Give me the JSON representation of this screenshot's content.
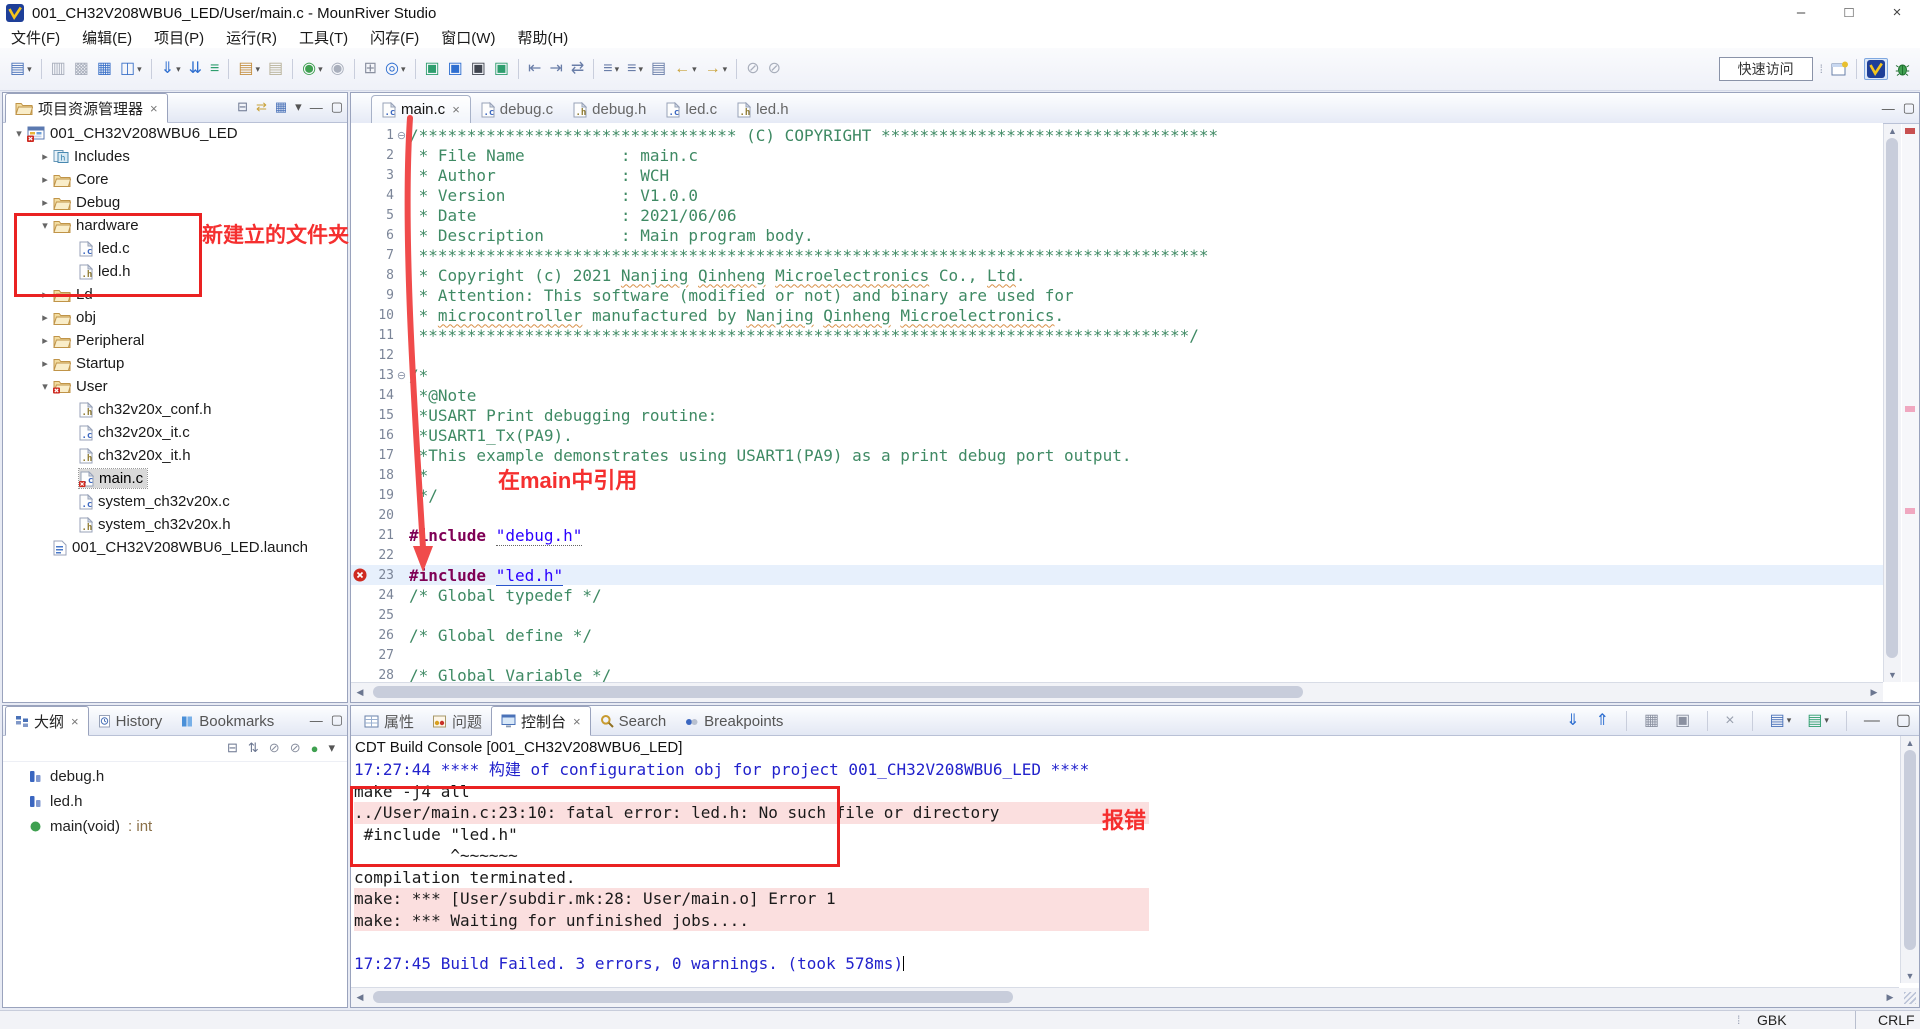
{
  "window": {
    "title": "001_CH32V208WBU6_LED/User/main.c - MounRiver Studio",
    "controls": {
      "minimize": "–",
      "maximize": "□",
      "close": "×"
    }
  },
  "menu": {
    "items": [
      "文件(F)",
      "编辑(E)",
      "项目(P)",
      "运行(R)",
      "工具(T)",
      "闪存(F)",
      "窗口(W)",
      "帮助(H)"
    ]
  },
  "toolbar": {
    "quick_access": "快速访问",
    "items": [
      {
        "name": "new-wizard",
        "g": "▤",
        "c": "#4A72B8",
        "dd": 1
      },
      {
        "sep": 1
      },
      {
        "name": "save",
        "g": "▥",
        "c": "#A9AFBC"
      },
      {
        "name": "save-all",
        "g": "▩",
        "c": "#A9AFBC"
      },
      {
        "name": "open-windows",
        "g": "▦",
        "c": "#3C72C8"
      },
      {
        "name": "perspective-config",
        "g": "◫",
        "c": "#3C72C8",
        "dd": 1
      },
      {
        "sep": 1
      },
      {
        "name": "download",
        "g": "⇓",
        "c": "#2F6FD0",
        "dd": 1
      },
      {
        "name": "download-all",
        "g": "⇊",
        "c": "#2F6FD0"
      },
      {
        "name": "library",
        "g": "≡",
        "c": "#2E9E6E"
      },
      {
        "sep": 1
      },
      {
        "name": "flash",
        "g": "▤",
        "c": "#C49043",
        "dd": 1
      },
      {
        "name": "erase",
        "g": "▤",
        "c": "#B8B29A"
      },
      {
        "sep": 1
      },
      {
        "name": "debug",
        "g": "◉",
        "c": "#3FA050",
        "dd": 1
      },
      {
        "name": "attach-debug",
        "g": "◉",
        "c": "#A9AFBC"
      },
      {
        "sep": 1
      },
      {
        "name": "hierarchy",
        "g": "⊞",
        "c": "#8A90A0"
      },
      {
        "name": "browse",
        "g": "◎",
        "c": "#2F6FD0",
        "dd": 1
      },
      {
        "sep": 1
      },
      {
        "name": "tool-id",
        "g": "▣",
        "c": "#2E9E6E"
      },
      {
        "name": "tool-help",
        "g": "▣",
        "c": "#2F6FD0"
      },
      {
        "name": "terminal",
        "g": "▣",
        "c": "#40454F"
      },
      {
        "name": "tool-k",
        "g": "▣",
        "c": "#2E9E6E"
      },
      {
        "sep": 1
      },
      {
        "name": "shift-left",
        "g": "⇤",
        "c": "#6A7EA8"
      },
      {
        "name": "shift-right",
        "g": "⇥",
        "c": "#6A7EA8"
      },
      {
        "name": "format",
        "g": "⇄",
        "c": "#6A7EA8"
      },
      {
        "sep": 1
      },
      {
        "name": "sort-a",
        "g": "≡",
        "c": "#6A7EA8",
        "dd": 1
      },
      {
        "name": "sort-b",
        "g": "≡",
        "c": "#6A7EA8",
        "dd": 1
      },
      {
        "name": "last-edit",
        "g": "▤",
        "c": "#6A7EA8"
      },
      {
        "name": "back",
        "g": "←",
        "c": "#C9A23A",
        "dd": 1
      },
      {
        "name": "forward",
        "g": "→",
        "c": "#C9A23A",
        "dd": 1
      },
      {
        "sep": 1
      },
      {
        "name": "pin-a",
        "g": "⊘",
        "c": "#A9AFBC"
      },
      {
        "name": "pin-b",
        "g": "⊘",
        "c": "#A9AFBC"
      }
    ]
  },
  "explorer": {
    "tab": "项目资源管理器",
    "tools": [
      {
        "name": "collapse-all",
        "g": "⊟",
        "c": "#6B7690"
      },
      {
        "name": "link-with-editor",
        "g": "⇄",
        "c": "#C9A23A"
      },
      {
        "name": "focus-active",
        "g": "▦",
        "c": "#4A72B8"
      },
      {
        "name": "view-menu",
        "g": "▾",
        "c": "#555"
      },
      {
        "name": "minimize",
        "g": "—",
        "c": "#555"
      },
      {
        "name": "maximize",
        "g": "▢",
        "c": "#555"
      }
    ],
    "tree": [
      {
        "label": "001_CH32V208WBU6_LED",
        "d": 0,
        "ch": "v",
        "icon": "project"
      },
      {
        "label": "Includes",
        "d": 1,
        "ch": ">",
        "icon": "includes"
      },
      {
        "label": "Core",
        "d": 1,
        "ch": ">",
        "icon": "folder"
      },
      {
        "label": "Debug",
        "d": 1,
        "ch": ">",
        "icon": "folder"
      },
      {
        "label": "hardware",
        "d": 1,
        "ch": "v",
        "icon": "folder"
      },
      {
        "label": "led.c",
        "d": 2,
        "icon": "cfile"
      },
      {
        "label": "led.h",
        "d": 2,
        "icon": "hfile"
      },
      {
        "label": "Ld",
        "d": 1,
        "ch": ">",
        "icon": "folder"
      },
      {
        "label": "obj",
        "d": 1,
        "ch": ">",
        "icon": "folder"
      },
      {
        "label": "Peripheral",
        "d": 1,
        "ch": ">",
        "icon": "folder"
      },
      {
        "label": "Startup",
        "d": 1,
        "ch": ">",
        "icon": "folder"
      },
      {
        "label": "User",
        "d": 1,
        "ch": "v",
        "icon": "folderErr"
      },
      {
        "label": "ch32v20x_conf.h",
        "d": 2,
        "icon": "hfile"
      },
      {
        "label": "ch32v20x_it.c",
        "d": 2,
        "icon": "cfile"
      },
      {
        "label": "ch32v20x_it.h",
        "d": 2,
        "icon": "hfile"
      },
      {
        "label": "main.c",
        "d": 2,
        "icon": "cfileErr",
        "selected": true
      },
      {
        "label": "system_ch32v20x.c",
        "d": 2,
        "icon": "cfile"
      },
      {
        "label": "system_ch32v20x.h",
        "d": 2,
        "icon": "hfile"
      },
      {
        "label": "001_CH32V208WBU6_LED.launch",
        "d": 1,
        "icon": "launch"
      }
    ]
  },
  "editor": {
    "tabs": [
      {
        "label": "main.c",
        "icon": "cfile",
        "active": true,
        "closable": true
      },
      {
        "label": "debug.c",
        "icon": "cfile"
      },
      {
        "label": "debug.h",
        "icon": "hfile"
      },
      {
        "label": "led.c",
        "icon": "cfile"
      },
      {
        "label": "led.h",
        "icon": "hfile"
      }
    ],
    "winbtns": [
      {
        "name": "minimize",
        "g": "—"
      },
      {
        "name": "maximize",
        "g": "▢"
      }
    ],
    "lines": [
      {
        "n": 1,
        "fold": "⊖",
        "segs": [
          {
            "c": "cmt",
            "t": "/********************************* (C) COPYRIGHT ***********************************"
          }
        ]
      },
      {
        "n": 2,
        "segs": [
          {
            "c": "cmt",
            "t": " * File Name          : main.c"
          }
        ]
      },
      {
        "n": 3,
        "segs": [
          {
            "c": "cmt",
            "t": " * Author             : WCH"
          }
        ]
      },
      {
        "n": 4,
        "segs": [
          {
            "c": "cmt",
            "t": " * Version            : V1.0.0"
          }
        ]
      },
      {
        "n": 5,
        "segs": [
          {
            "c": "cmt",
            "t": " * Date               : 2021/06/06"
          }
        ]
      },
      {
        "n": 6,
        "segs": [
          {
            "c": "cmt",
            "t": " * Description        : Main program body."
          }
        ]
      },
      {
        "n": 7,
        "segs": [
          {
            "c": "cmt",
            "t": " **********************************************************************************"
          }
        ]
      },
      {
        "n": 8,
        "segs": [
          {
            "c": "cmt",
            "t": " * Copyright (c) 2021 "
          },
          {
            "c": "cmt sp",
            "t": "Nanjing"
          },
          {
            "c": "cmt",
            "t": " "
          },
          {
            "c": "cmt sp",
            "t": "Qinheng"
          },
          {
            "c": "cmt",
            "t": " "
          },
          {
            "c": "cmt sp",
            "t": "Microelectronics"
          },
          {
            "c": "cmt",
            "t": " Co., "
          },
          {
            "c": "cmt sp",
            "t": "Ltd"
          },
          {
            "c": "cmt",
            "t": "."
          }
        ]
      },
      {
        "n": 9,
        "segs": [
          {
            "c": "cmt",
            "t": " * Attention: This software (modified or not) and binary are used for"
          }
        ]
      },
      {
        "n": 10,
        "segs": [
          {
            "c": "cmt",
            "t": " * "
          },
          {
            "c": "cmt sp",
            "t": "microcontroller"
          },
          {
            "c": "cmt",
            "t": " manufactured by "
          },
          {
            "c": "cmt sp",
            "t": "Nanjing"
          },
          {
            "c": "cmt",
            "t": " "
          },
          {
            "c": "cmt sp",
            "t": "Qinheng"
          },
          {
            "c": "cmt",
            "t": " "
          },
          {
            "c": "cmt sp",
            "t": "Microelectronics"
          },
          {
            "c": "cmt",
            "t": "."
          }
        ]
      },
      {
        "n": 11,
        "segs": [
          {
            "c": "cmt",
            "t": " ********************************************************************************/"
          }
        ]
      },
      {
        "n": 12,
        "segs": []
      },
      {
        "n": 13,
        "fold": "⊖",
        "segs": [
          {
            "c": "cmt",
            "t": "/*"
          }
        ]
      },
      {
        "n": 14,
        "segs": [
          {
            "c": "cmt",
            "t": " *@Note"
          }
        ]
      },
      {
        "n": 15,
        "segs": [
          {
            "c": "cmt",
            "t": " *USART Print debugging routine:"
          }
        ]
      },
      {
        "n": 16,
        "segs": [
          {
            "c": "cmt",
            "t": " *USART1_Tx(PA9)."
          }
        ]
      },
      {
        "n": 17,
        "segs": [
          {
            "c": "cmt",
            "t": " *This example demonstrates using USART1(PA9) as a print debug port output."
          }
        ]
      },
      {
        "n": 18,
        "segs": [
          {
            "c": "cmt",
            "t": " *"
          }
        ]
      },
      {
        "n": 19,
        "segs": [
          {
            "c": "cmt",
            "t": " */"
          }
        ]
      },
      {
        "n": 20,
        "segs": []
      },
      {
        "n": 21,
        "segs": [
          {
            "c": "kw",
            "t": "#include"
          },
          {
            "t": " "
          },
          {
            "c": "str udot",
            "t": "\"debug.h\""
          }
        ]
      },
      {
        "n": 22,
        "segs": []
      },
      {
        "n": 23,
        "err": true,
        "segs": [
          {
            "c": "kw",
            "t": "#include"
          },
          {
            "t": " "
          },
          {
            "c": "str usol",
            "t": "\"led.h\""
          }
        ]
      },
      {
        "n": 24,
        "segs": [
          {
            "c": "cmt",
            "t": "/* Global typedef */"
          }
        ]
      },
      {
        "n": 25,
        "segs": []
      },
      {
        "n": 26,
        "segs": [
          {
            "c": "cmt",
            "t": "/* Global define */"
          }
        ]
      },
      {
        "n": 27,
        "segs": []
      },
      {
        "n": 28,
        "segs": [
          {
            "c": "cmt",
            "t": "/* Global Variable */"
          }
        ]
      }
    ]
  },
  "outline": {
    "tabs": [
      {
        "label": "大纲",
        "icon": "outlineTab",
        "active": true,
        "closable": true
      },
      {
        "label": "History",
        "icon": "historyIcon"
      },
      {
        "label": "Bookmarks",
        "icon": "bookmarksIcon"
      }
    ],
    "tools": [
      {
        "name": "collapse-all",
        "g": "⊟",
        "c": "#6B7690"
      },
      {
        "name": "sort",
        "g": "⇅",
        "c": "#6B7690"
      },
      {
        "name": "hide-fields",
        "g": "⊘",
        "c": "#8A90A0"
      },
      {
        "name": "hide-static",
        "g": "⊘",
        "c": "#8A90A0"
      },
      {
        "name": "hide-non-public",
        "g": "●",
        "c": "#3FA050"
      },
      {
        "name": "view-menu",
        "g": "▾",
        "c": "#555"
      }
    ],
    "items": [
      {
        "label": "debug.h",
        "suffix": "",
        "icon": "outlineInc"
      },
      {
        "label": "led.h",
        "suffix": "",
        "icon": "outlineInc"
      },
      {
        "label": "main(void)",
        "suffix": " : int",
        "icon": "fnDot"
      }
    ]
  },
  "console": {
    "tabs": [
      {
        "label": "属性",
        "icon": "propertiesIcon"
      },
      {
        "label": "问题",
        "icon": "problemsIcon"
      },
      {
        "label": "控制台",
        "icon": "consoleIcon",
        "active": true,
        "closable": true
      },
      {
        "label": "Search",
        "icon": "searchIcon"
      },
      {
        "label": "Breakpoints",
        "icon": "breakpointsIcon"
      }
    ],
    "tools": [
      {
        "name": "scroll-lock-down",
        "g": "⇓",
        "c": "#2F6FD0"
      },
      {
        "name": "scroll-lock-up",
        "g": "⇑",
        "c": "#2F6FD0"
      },
      {
        "sep": 1
      },
      {
        "name": "word-wrap",
        "g": "▦",
        "c": "#8A90A0"
      },
      {
        "name": "clear-console",
        "g": "▣",
        "c": "#8A90A0"
      },
      {
        "sep": 1
      },
      {
        "name": "terminate",
        "g": "×",
        "c": "#99A0AE"
      },
      {
        "sep": 1
      },
      {
        "name": "pin-console",
        "g": "▤",
        "c": "#4A72B8",
        "dd": 1
      },
      {
        "name": "open-console",
        "g": "▤",
        "c": "#2E9E6E",
        "dd": 1
      },
      {
        "sep": 1
      },
      {
        "name": "minimize",
        "g": "—",
        "c": "#555"
      },
      {
        "name": "maximize",
        "g": "▢",
        "c": "#555"
      }
    ],
    "header": "CDT Build Console [001_CH32V208WBU6_LED]",
    "lines": [
      {
        "cls": "blue",
        "t": "17:27:44 **** 构建 of configuration obj for project 001_CH32V208WBU6_LED ****"
      },
      {
        "cls": "",
        "t": "make -j4 all"
      },
      {
        "cls": "pink",
        "t": "../User/main.c:23:10: fatal error: led.h: No such file or directory"
      },
      {
        "cls": "",
        "t": " #include \"led.h\""
      },
      {
        "cls": "",
        "t": "          ^~~~~~~"
      },
      {
        "cls": "",
        "t": "compilation terminated."
      },
      {
        "cls": "pink",
        "t": "make: *** [User/subdir.mk:28: User/main.o] Error 1"
      },
      {
        "cls": "pink",
        "t": "make: *** Waiting for unfinished jobs...."
      },
      {
        "cls": "",
        "t": ""
      },
      {
        "cls": "blue",
        "t": "17:27:45 Build Failed. 3 errors, 0 warnings. (took 578ms)",
        "cursor": true
      }
    ]
  },
  "status": {
    "encoding": "GBK",
    "line_ending": "CRLF"
  },
  "annotations": {
    "folder_note": "新建立的文件夹",
    "main_note": "在main中引用",
    "error_note": "报错"
  }
}
